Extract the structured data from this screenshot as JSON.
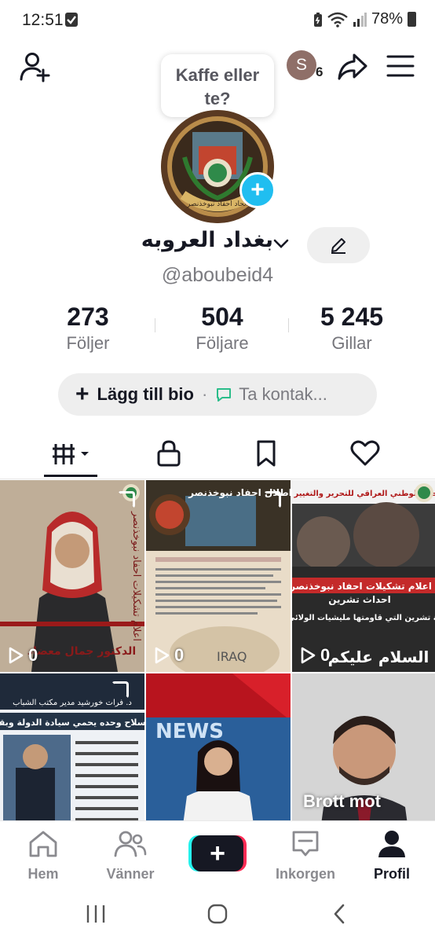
{
  "status_bar": {
    "time": "12:51",
    "battery": "78%",
    "icons": [
      "check-icon",
      "battery-saver-icon",
      "wifi-icon",
      "signal-icon",
      "battery-icon"
    ]
  },
  "top_bar": {
    "icons": [
      "add-user-icon",
      "share-icon",
      "menu-icon"
    ],
    "avatar_initial": "S",
    "avatar_badge": "6"
  },
  "bubble": {
    "text_line1": "Kaffe eller",
    "text_line2": "te?"
  },
  "profile": {
    "display_name": "بغداد العروبه",
    "username": "@aboubeid4",
    "avatar_overlay_text": "اتحاد احفاد نبوخذنصر"
  },
  "stats": [
    {
      "value": "273",
      "label": "Följer"
    },
    {
      "value": "504",
      "label": "Följare"
    },
    {
      "value": "5 245",
      "label": "Gillar"
    }
  ],
  "bio": {
    "add_label": "Lägg till bio",
    "separator": "·",
    "contact_label": "Ta kontak..."
  },
  "tabs": [
    {
      "name": "videos",
      "icon": "grid-icon"
    },
    {
      "name": "private",
      "icon": "lock-icon"
    },
    {
      "name": "saved",
      "icon": "bookmark-icon"
    },
    {
      "name": "liked",
      "icon": "heart-icon"
    }
  ],
  "videos": [
    {
      "views": "0",
      "overlay": "الدكتور جمال معضاد",
      "side_text": "اعلام تشكيلات احفاد نبوخذنصر"
    },
    {
      "views": "0",
      "overlay": "IRAQ",
      "heading": "اطلال احفاد نبوخذنصر"
    },
    {
      "views": "0",
      "overlay": "هذه هي فتنة تشرين التي قاومتها مليشيات الولائي هادي العامري !!!",
      "heading": "التجمع الوطني العراقي للتحرير والتغيير",
      "tag": "#اعلام تشكيلات احفاد نبوخذنصر",
      "sub": "احداث تشرين",
      "bottom": "السلام عليكم"
    },
    {
      "views": "",
      "overlay": "هل السلاح وحده يحمي سيادة الدولة وبقائها ؟",
      "heading": "د. فرات خورشيد مدير مكتب الشباب"
    },
    {
      "views": "",
      "overlay": "NEWS"
    },
    {
      "views": "",
      "caption": "Brott mot"
    }
  ],
  "bottom_nav": [
    {
      "label": "Hem",
      "icon": "home-icon"
    },
    {
      "label": "Vänner",
      "icon": "friends-icon"
    },
    {
      "label": "",
      "icon": "plus-icon"
    },
    {
      "label": "Inkorgen",
      "icon": "inbox-icon"
    },
    {
      "label": "Profil",
      "icon": "profile-icon"
    }
  ],
  "colors": {
    "accent_cyan": "#25f4ee",
    "accent_pink": "#fe2c55",
    "add_photo_blue": "#20bef0",
    "contact_green": "#2bbd8a",
    "text_primary": "#161823",
    "text_secondary": "#7b7b80"
  }
}
